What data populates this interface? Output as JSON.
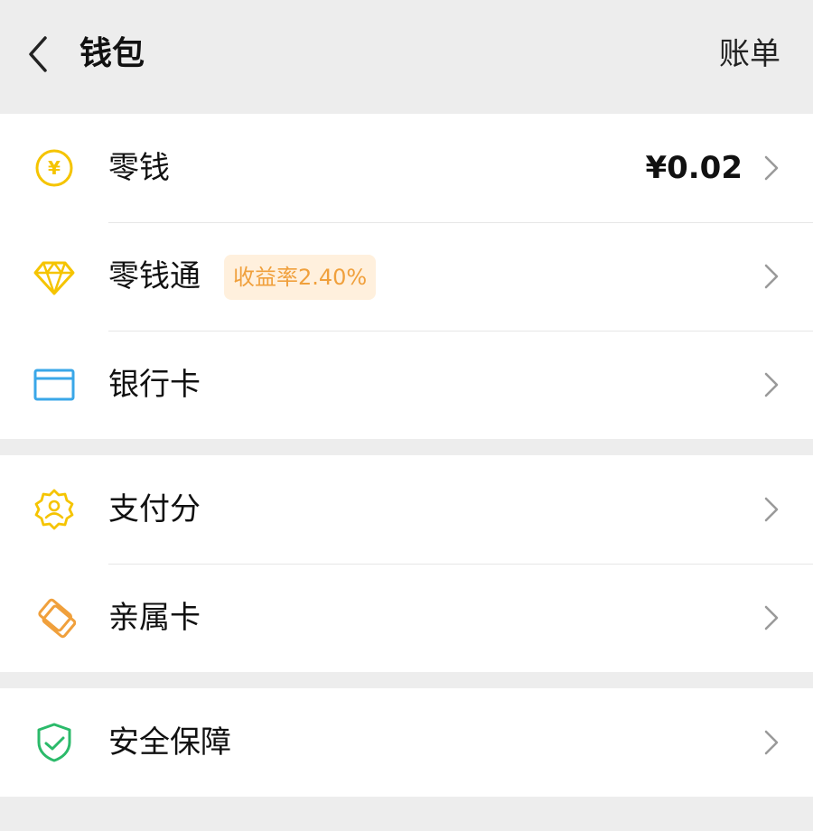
{
  "header": {
    "title": "钱包",
    "bill_label": "账单"
  },
  "groups": [
    {
      "items": [
        {
          "label": "零钱",
          "value": "¥0.02",
          "icon": "yuan-coin-icon"
        },
        {
          "label": "零钱通",
          "badge": "收益率2.40%",
          "icon": "diamond-icon"
        },
        {
          "label": "银行卡",
          "icon": "bank-card-icon"
        }
      ]
    },
    {
      "items": [
        {
          "label": "支付分",
          "icon": "pay-score-badge-icon"
        },
        {
          "label": "亲属卡",
          "icon": "family-card-icon"
        }
      ]
    },
    {
      "items": [
        {
          "label": "安全保障",
          "icon": "shield-check-icon"
        }
      ]
    }
  ],
  "colors": {
    "yellow": "#f5c400",
    "blue": "#3aa7e8",
    "orange": "#f0a03c",
    "green": "#2bba6a",
    "badge_bg": "#fff0dd",
    "page_bg": "#ededed"
  }
}
